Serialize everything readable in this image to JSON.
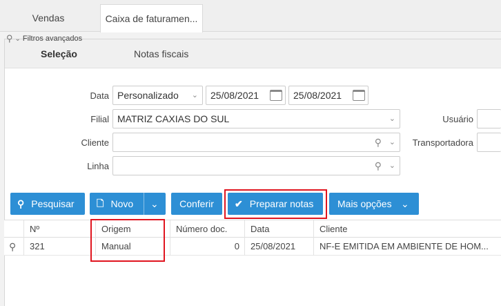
{
  "top_tabs": [
    "Vendas",
    "Caixa de faturamen..."
  ],
  "sub_tabs": [
    "Seleção",
    "Notas fiscais"
  ],
  "filters": {
    "advanced_label": "Filtros avançados",
    "data_label": "Data",
    "data_mode": "Personalizado",
    "date_from": "25/08/2021",
    "date_to": "25/08/2021",
    "filial_label": "Filial",
    "filial_value": "MATRIZ CAXIAS DO SUL",
    "cliente_label": "Cliente",
    "cliente_value": "",
    "linha_label": "Linha",
    "linha_value": "",
    "usuario_label": "Usuário",
    "transportadora_label": "Transportadora"
  },
  "toolbar": {
    "pesquisar": "Pesquisar",
    "novo": "Novo",
    "conferir": "Conferir",
    "preparar": "Preparar notas",
    "mais": "Mais opções"
  },
  "table": {
    "headers": [
      "Nº",
      "Origem",
      "Número doc.",
      "Data",
      "Cliente"
    ],
    "rows": [
      [
        "321",
        "Manual",
        "0",
        "25/08/2021",
        "NF-E EMITIDA EM AMBIENTE DE HOM..."
      ]
    ]
  },
  "colors": {
    "accent": "#2d8fd5",
    "highlight": "#e0141e"
  }
}
